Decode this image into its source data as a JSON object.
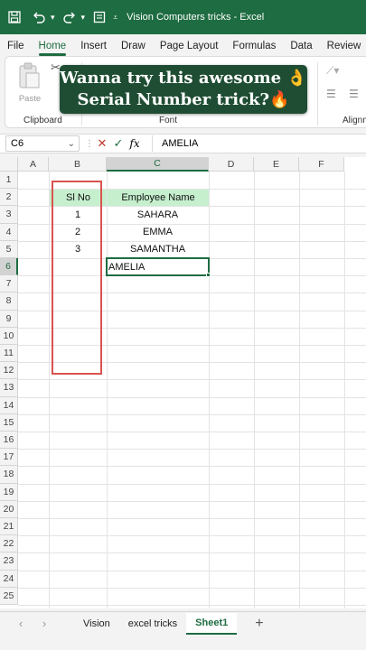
{
  "window": {
    "title": "Vision Computers tricks  -  Excel",
    "icons": [
      "save-icon",
      "undo-icon",
      "redo-icon",
      "customize-icon"
    ]
  },
  "ribbon_tabs": [
    {
      "label": "File",
      "active": false
    },
    {
      "label": "Home",
      "active": true
    },
    {
      "label": "Insert",
      "active": false
    },
    {
      "label": "Draw",
      "active": false
    },
    {
      "label": "Page Layout",
      "active": false
    },
    {
      "label": "Formulas",
      "active": false
    },
    {
      "label": "Data",
      "active": false
    },
    {
      "label": "Review",
      "active": false
    }
  ],
  "ribbon_groups": {
    "clipboard": "Clipboard",
    "paste": "Paste",
    "font": "Font",
    "alignment": "Alignm"
  },
  "banner": {
    "line1": "Wanna try this awesome 👌",
    "line2": "Serial Number trick?🔥"
  },
  "formula_bar": {
    "name_box": "C6",
    "fx_label": "fx",
    "value": "AMELIA"
  },
  "columns": [
    "A",
    "B",
    "C",
    "D",
    "E",
    "F"
  ],
  "rows": [
    "1",
    "2",
    "3",
    "4",
    "5",
    "6",
    "7",
    "8",
    "9",
    "10",
    "11",
    "12",
    "13",
    "14",
    "15",
    "16",
    "17",
    "18",
    "19",
    "20",
    "21",
    "22",
    "23",
    "24",
    "25"
  ],
  "selected": {
    "column": "C",
    "row": "6"
  },
  "table": {
    "headers": {
      "sl_no": "Sl No",
      "employee_name": "Employee Name"
    },
    "rows": [
      {
        "sl_no": "1",
        "name": "SAHARA"
      },
      {
        "sl_no": "2",
        "name": "EMMA"
      },
      {
        "sl_no": "3",
        "name": "SAMANTHA"
      },
      {
        "sl_no": "",
        "name": "AMELIA"
      }
    ]
  },
  "sheet_tabs": [
    {
      "label": "Vision",
      "active": false
    },
    {
      "label": "excel tricks",
      "active": false
    },
    {
      "label": "Sheet1",
      "active": true
    }
  ],
  "colors": {
    "excel_green": "#1e6c41",
    "header_fill": "#c6efce",
    "highlight_box": "#d9534f",
    "banner_bg": "#1f4d33"
  }
}
